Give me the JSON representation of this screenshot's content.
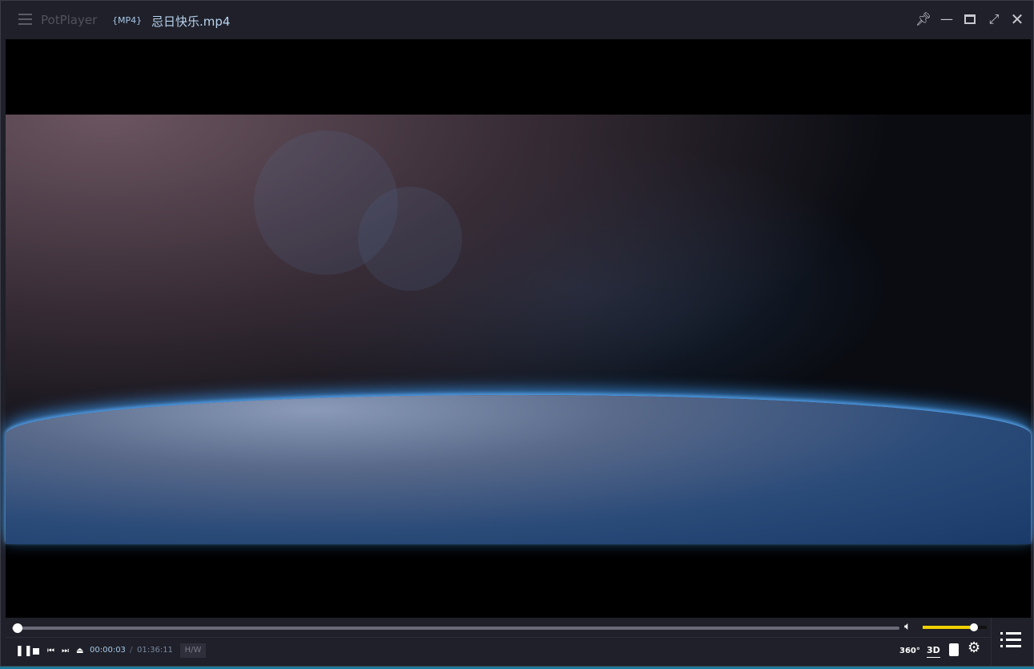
{
  "window": {
    "app_name": "PotPlayer",
    "format_badge": "{MP4}",
    "file_name": "忌日快乐.mp4"
  },
  "controls": {
    "current_time": "00:00:03",
    "time_separator": "/",
    "total_time": "01:36:11",
    "hw_label": "H/W",
    "progress_percent": 0.05,
    "volume_percent": 80,
    "label_360": "360°",
    "label_3d": "3D"
  },
  "colors": {
    "accent": "#f0d000",
    "background": "#1f2029"
  }
}
